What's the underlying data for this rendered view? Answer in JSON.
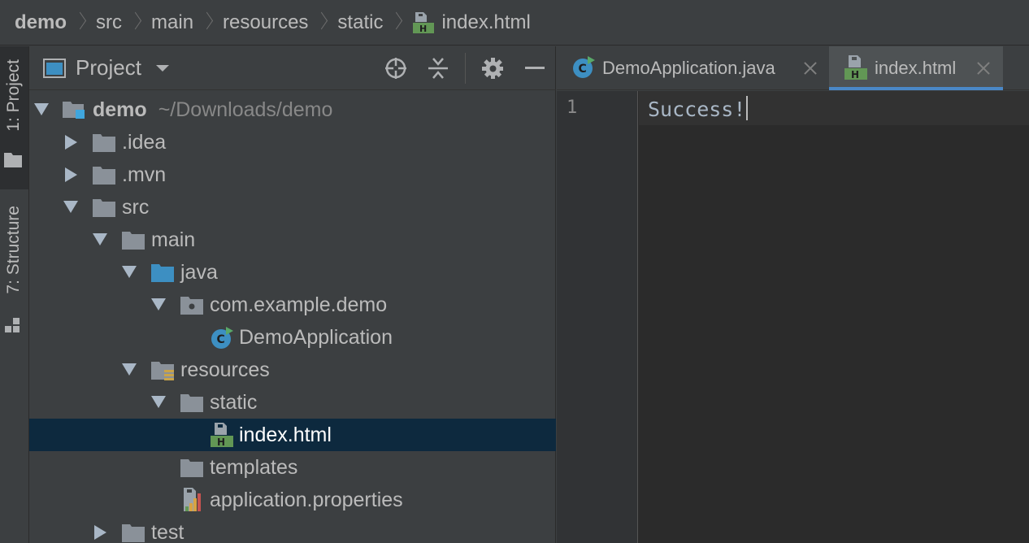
{
  "breadcrumb": {
    "items": [
      "demo",
      "src",
      "main",
      "resources",
      "static",
      "index.html"
    ]
  },
  "side_strip": {
    "project_tab": "1: Project",
    "structure_tab": "7: Structure"
  },
  "project_panel": {
    "title": "Project",
    "tree": [
      {
        "label": "demo",
        "hint": "~/Downloads/demo"
      },
      {
        "label": ".idea"
      },
      {
        "label": ".mvn"
      },
      {
        "label": "src"
      },
      {
        "label": "main"
      },
      {
        "label": "java"
      },
      {
        "label": "com.example.demo"
      },
      {
        "label": "DemoApplication"
      },
      {
        "label": "resources"
      },
      {
        "label": "static"
      },
      {
        "label": "index.html"
      },
      {
        "label": "templates"
      },
      {
        "label": "application.properties"
      },
      {
        "label": "test"
      }
    ]
  },
  "editor": {
    "tabs": [
      {
        "label": "DemoApplication.java"
      },
      {
        "label": "index.html"
      }
    ],
    "line_number": "1",
    "code_line": "Success!"
  },
  "colors": {
    "selection": "#0d293e",
    "folder": "#8a9199",
    "source_folder": "#3d8fc2",
    "html_green": "#629755",
    "tab_underline": "#4a88c7"
  }
}
